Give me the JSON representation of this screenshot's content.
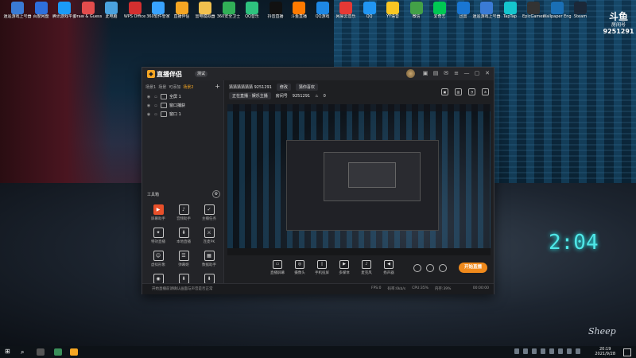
{
  "desktop": {
    "icons": [
      {
        "label": "逍遥游戏上号器",
        "color": "#3a7bd5"
      },
      {
        "label": "百度网盘",
        "color": "#2e6fdc"
      },
      {
        "label": "腾讯游戏平台",
        "color": "#1b9af7"
      },
      {
        "label": "Draw & Guess",
        "color": "#e44c4c"
      },
      {
        "label": "此电脑",
        "color": "#4aa3df"
      },
      {
        "label": "WPS Office",
        "color": "#d32f2f"
      },
      {
        "label": "360软件管家",
        "color": "#38a3ff"
      },
      {
        "label": "直播伴侣",
        "color": "#f5a623"
      },
      {
        "label": "雷电模拟器",
        "color": "#f2c14e"
      },
      {
        "label": "360安全卫士",
        "color": "#31b057"
      },
      {
        "label": "QQ音乐",
        "color": "#2ec27e"
      },
      {
        "label": "抖音直播",
        "color": "#111111"
      },
      {
        "label": "斗鱼直播",
        "color": "#ff7a00"
      },
      {
        "label": "QQ游戏",
        "color": "#1e88e5"
      },
      {
        "label": "网易云音乐",
        "color": "#e53935"
      },
      {
        "label": "QQ",
        "color": "#2196f3"
      },
      {
        "label": "YY语音",
        "color": "#f9c623"
      },
      {
        "label": "微信",
        "color": "#43a047"
      },
      {
        "label": "爱奇艺",
        "color": "#00c853"
      },
      {
        "label": "迅雷",
        "color": "#1976d2"
      },
      {
        "label": "逍遥游戏上号器",
        "color": "#3a7bd5"
      },
      {
        "label": "TapTap",
        "color": "#15c5ce"
      },
      {
        "label": "EpicGames",
        "color": "#333333"
      },
      {
        "label": "Wallpaper Engine",
        "color": "#1a6fb5"
      },
      {
        "label": "Steam",
        "color": "#1b2838"
      }
    ]
  },
  "room": {
    "logo": "斗鱼",
    "title": "房间号",
    "number": "9251291"
  },
  "clock_text": "2:04",
  "signature": "Sheep",
  "app": {
    "name": "直播伴侣",
    "version": "测试",
    "tabs": [
      "场景1",
      "场景",
      "可添加",
      "场景2"
    ],
    "active_tab": 3,
    "sources": [
      {
        "label": "全屏 1"
      },
      {
        "label": "窗口捕获"
      },
      {
        "label": "窗口 1"
      }
    ],
    "tools_title": "工具箱",
    "tools": [
      {
        "label": "屏幕助手",
        "icon": "▶",
        "hot": true
      },
      {
        "label": "音频助手",
        "icon": "♪",
        "hot": false
      },
      {
        "label": "主播任务",
        "icon": "✓",
        "hot": false
      },
      {
        "label": "特效直播",
        "icon": "✦",
        "hot": false
      },
      {
        "label": "本地直播",
        "icon": "⬇",
        "hot": false
      },
      {
        "label": "连麦PK",
        "icon": "⚔",
        "hot": false
      },
      {
        "label": "虚拟形象",
        "icon": "☺",
        "hot": false
      },
      {
        "label": "弹幕姬",
        "icon": "☰",
        "hot": false
      },
      {
        "label": "数据助手",
        "icon": "▦",
        "hot": false
      },
      {
        "label": "游戏直播",
        "icon": "◉",
        "hot": false
      },
      {
        "label": "下载",
        "icon": "⬇",
        "hot": false
      },
      {
        "label": "更多",
        "icon": "⬇",
        "hot": false
      }
    ],
    "info": {
      "room_name": "猜猜猜猜猜猜 9251291",
      "edit": "修改",
      "category": "猜你喜欢",
      "tags": "正在直播 · 娱乐主播",
      "room_label": "房间号",
      "room_no": "9251291",
      "heat": "0"
    },
    "controls": [
      {
        "label": "直播屏幕",
        "icon": "▭"
      },
      {
        "label": "摄像头",
        "icon": "◎"
      },
      {
        "label": "手机投屏",
        "icon": "▯"
      },
      {
        "label": "多媒体",
        "icon": "▶"
      },
      {
        "label": "麦克风",
        "icon": "♪"
      },
      {
        "label": "扬声器",
        "icon": "◀"
      }
    ],
    "live_button": "开始直播",
    "status": {
      "message": "开始直播前请确认画面与声音是否正常",
      "fps": "FPS:0",
      "bitrate": "码率:0kb/s",
      "cpu": "CPU:35%",
      "mem": "内存:39%",
      "time": "00:00:00"
    }
  },
  "taskbar": {
    "time": "20:19",
    "date": "2021/9/28"
  }
}
